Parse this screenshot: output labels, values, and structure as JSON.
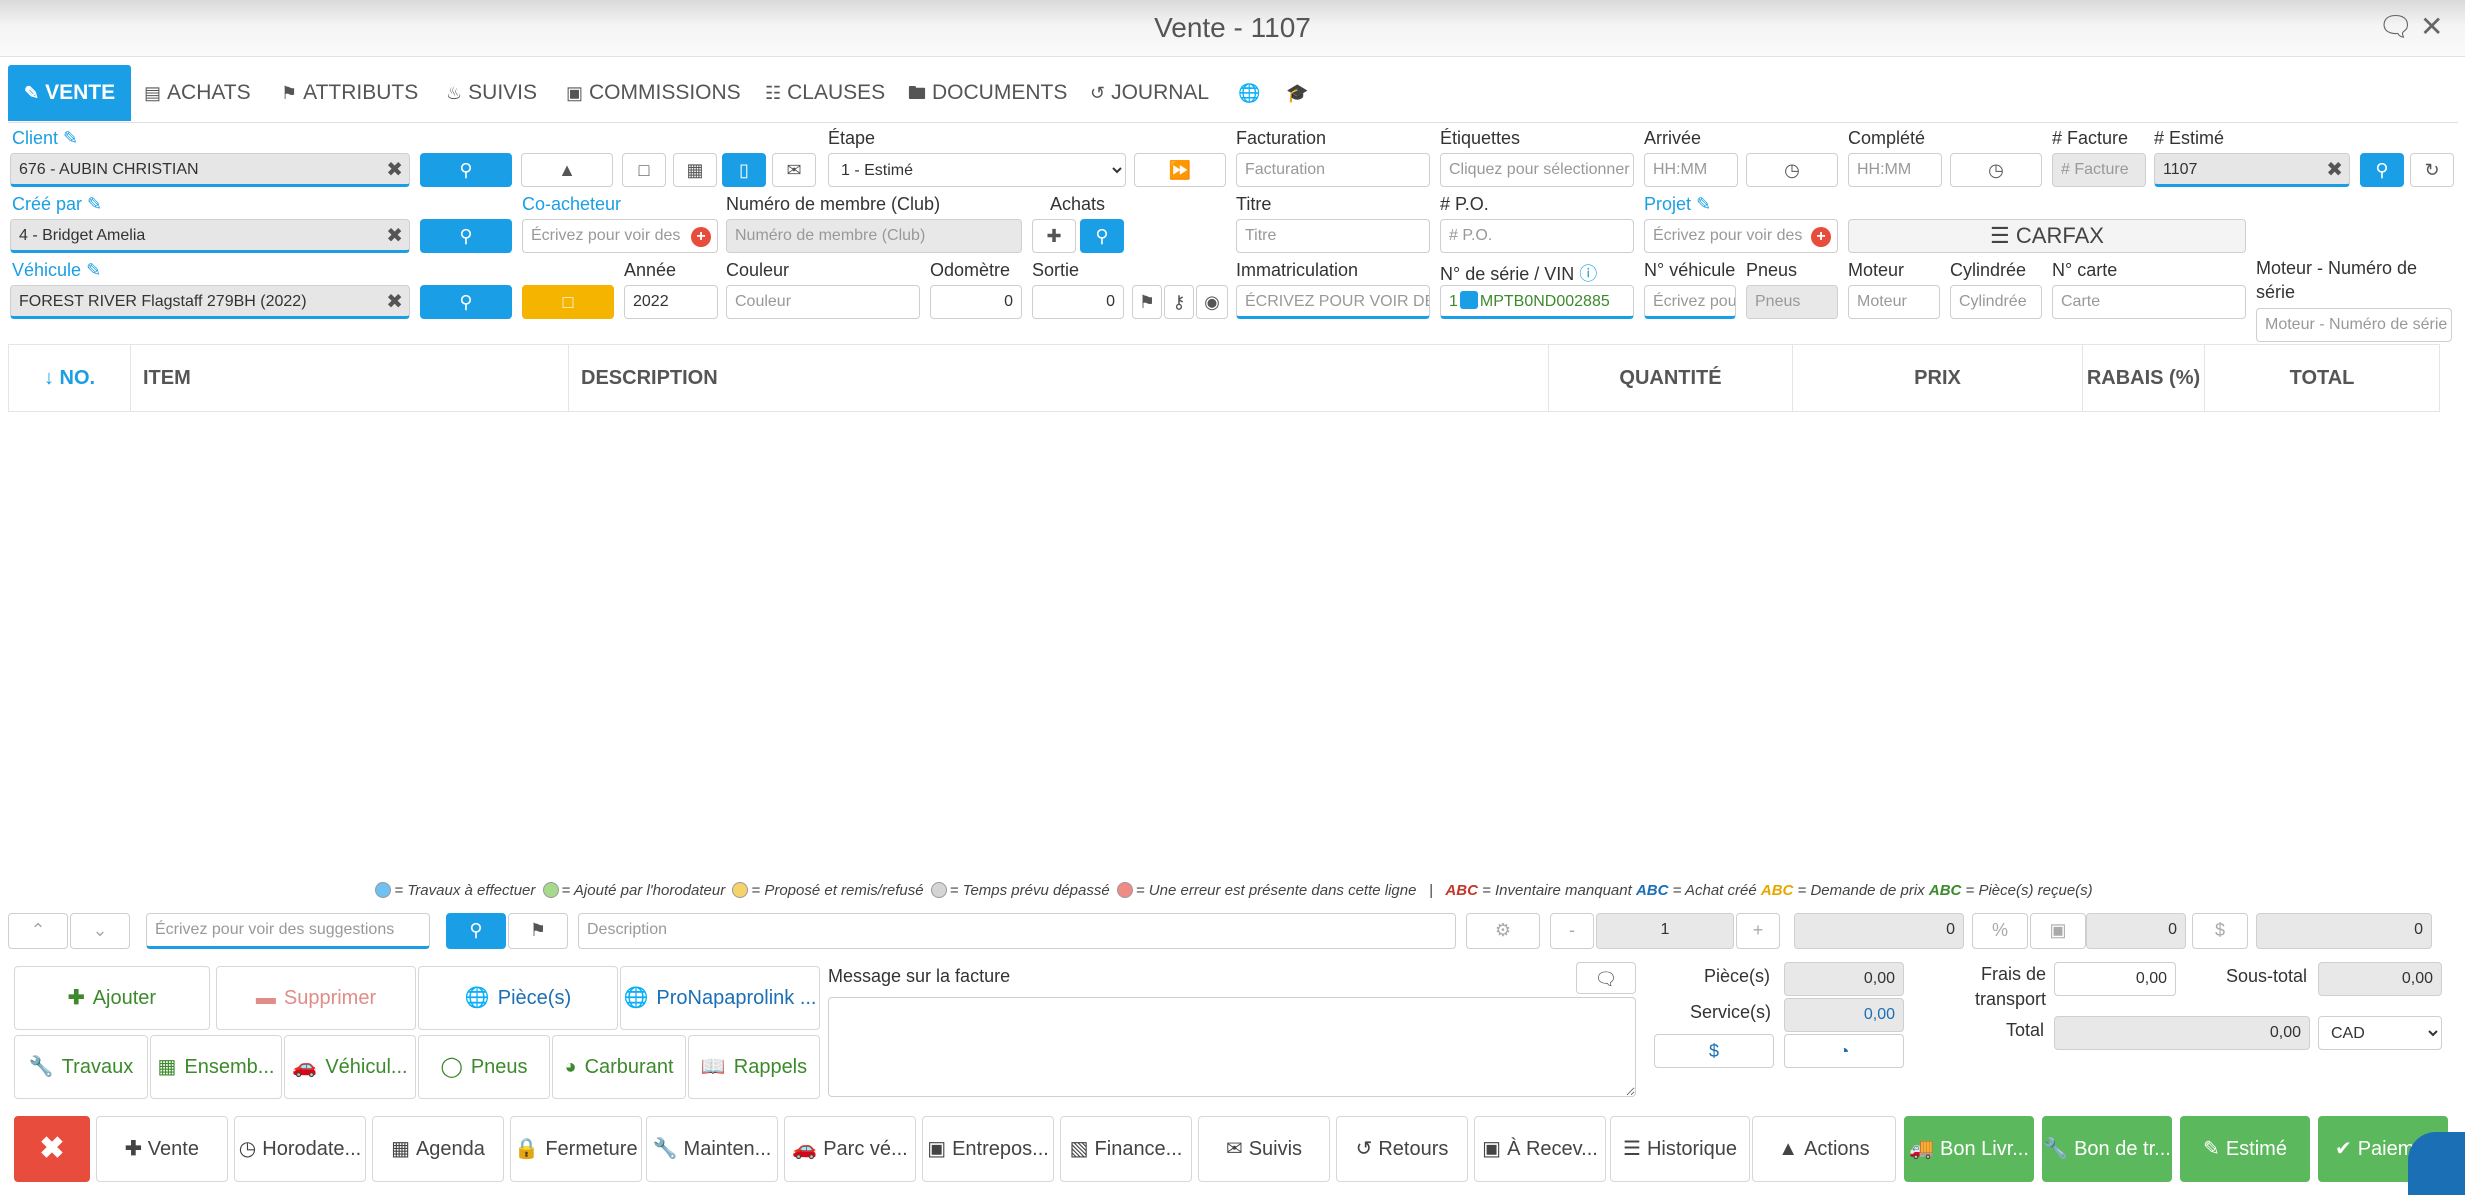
{
  "window": {
    "title": "Vente - 1107"
  },
  "tabs": [
    {
      "label": "VENTE",
      "icon": "edit-icon"
    },
    {
      "label": "ACHATS",
      "icon": "card-icon"
    },
    {
      "label": "ATTRIBUTS",
      "icon": "tags-icon"
    },
    {
      "label": "SUIVIS",
      "icon": "bell-icon"
    },
    {
      "label": "COMMISSIONS",
      "icon": "money-icon"
    },
    {
      "label": "CLAUSES",
      "icon": "file-icon"
    },
    {
      "label": "DOCUMENTS",
      "icon": "folder-icon"
    },
    {
      "label": "JOURNAL",
      "icon": "history-icon"
    }
  ],
  "form": {
    "client_label": "Client",
    "client_value": "676 - AUBIN CHRISTIAN",
    "cree_par_label": "Créé par",
    "cree_par_value": "4 - Bridget Amelia",
    "vehicule_label": "Véhicule",
    "vehicule_value": "FOREST RIVER Flagstaff 279BH (2022)",
    "etape_label": "Étape",
    "etape_value": "1 - Estimé",
    "coacheteur_label": "Co-acheteur",
    "coacheteur_placeholder": "Écrivez pour voir des",
    "membre_label": "Numéro de membre (Club)",
    "membre_placeholder": "Numéro de membre (Club)",
    "achats_label": "Achats",
    "annee_label": "Année",
    "annee_value": "2022",
    "couleur_label": "Couleur",
    "couleur_placeholder": "Couleur",
    "odometre_label": "Odomètre",
    "odometre_value": "0",
    "sortie_label": "Sortie",
    "sortie_value": "0",
    "facturation_label": "Facturation",
    "facturation_placeholder": "Facturation",
    "etiquettes_label": "Étiquettes",
    "etiquettes_placeholder": "Cliquez pour sélectionner",
    "arrivee_label": "Arrivée",
    "arrivee_placeholder": "HH:MM",
    "complete_label": "Complété",
    "complete_placeholder": "HH:MM",
    "facture_no_label": "# Facture",
    "facture_no_placeholder": "# Facture",
    "estime_no_label": "# Estimé",
    "estime_no_value": "1107",
    "titre_label": "Titre",
    "titre_placeholder": "Titre",
    "po_label": "# P.O.",
    "po_placeholder": "# P.O.",
    "projet_label": "Projet",
    "projet_placeholder": "Écrivez pour voir des",
    "carfax_label": "CARFAX",
    "immat_label": "Immatriculation",
    "immat_placeholder": "ÉCRIVEZ POUR VOIR DES",
    "vin_label": "N° de série / VIN",
    "vin_value": "MPTB0ND002885",
    "vin_prefix": "1",
    "no_vehicule_label": "N° véhicule",
    "no_vehicule_placeholder": "Écrivez pou",
    "pneus_label": "Pneus",
    "pneus_placeholder": "Pneus",
    "moteur_label": "Moteur",
    "moteur_placeholder": "Moteur",
    "cylindree_label": "Cylindrée",
    "cylindree_placeholder": "Cylindrée",
    "no_carte_label": "N° carte",
    "no_carte_placeholder": "Carte",
    "moteur_serie_label": "Moteur - Numéro de série",
    "moteur_serie_placeholder": "Moteur - Numéro de série"
  },
  "grid": {
    "columns": [
      "↓ NO.",
      "ITEM",
      "DESCRIPTION",
      "QUANTITÉ",
      "PRIX",
      "RABAIS (%)",
      "TOTAL"
    ]
  },
  "legend": {
    "travaux": "= Travaux à effectuer",
    "horodateur": "= Ajouté par l'horodateur",
    "propose": "= Proposé et remis/refusé",
    "temps": "= Temps prévu dépassé",
    "erreur": "= Une erreur est présente dans cette ligne",
    "sep": "|",
    "abc": "ABC",
    "inventaire": "= Inventaire manquant",
    "achat": "= Achat créé",
    "demande": "= Demande de prix",
    "recue": "= Pièce(s) reçue(s)",
    "colors": {
      "blue": "#6ec1f0",
      "green": "#a7d98c",
      "yellow": "#f6d36a",
      "grey": "#d5d5d5",
      "red": "#f08a85"
    }
  },
  "entry": {
    "suggest_placeholder": "Écrivez pour voir des suggestions",
    "description_placeholder": "Description",
    "minus": "-",
    "qty": "1",
    "plus": "+",
    "price": "0",
    "rabais": "0",
    "total": "0"
  },
  "actions": [
    {
      "label": "Ajouter",
      "icon": "plus-icon"
    },
    {
      "label": "Supprimer",
      "icon": "minus-icon"
    },
    {
      "label": "Pièce(s)",
      "icon": "globe-icon"
    },
    {
      "label": "ProNapaprolink ...",
      "icon": "globe-icon"
    },
    {
      "label": "Travaux",
      "icon": "wrench-icon"
    },
    {
      "label": "Ensemb...",
      "icon": "grid-icon"
    },
    {
      "label": "Véhicul...",
      "icon": "car-icon"
    },
    {
      "label": "Pneus",
      "icon": "circle-icon"
    },
    {
      "label": "Carburant",
      "icon": "gauge-icon"
    },
    {
      "label": "Rappels",
      "icon": "book-icon"
    }
  ],
  "message": {
    "label": "Message sur la facture"
  },
  "totals": {
    "pieces_label": "Pièce(s)",
    "pieces_value": "0,00",
    "services_label": "Service(s)",
    "services_value": "0,00",
    "frais_label": "Frais de transport",
    "frais_value": "0,00",
    "sous_total_label": "Sous-total",
    "sous_total_value": "0,00",
    "total_label": "Total",
    "total_value": "0,00",
    "currency": "CAD"
  },
  "bottom": [
    {
      "label": "",
      "icon": "close-icon"
    },
    {
      "label": "Vente",
      "icon": "plus-icon"
    },
    {
      "label": "Horodate...",
      "icon": "clock-icon"
    },
    {
      "label": "Agenda",
      "icon": "calendar-icon"
    },
    {
      "label": "Fermeture",
      "icon": "lock-icon"
    },
    {
      "label": "Mainten...",
      "icon": "wrench-icon"
    },
    {
      "label": "Parc vé...",
      "icon": "car-icon"
    },
    {
      "label": "Entrepos...",
      "icon": "box-icon"
    },
    {
      "label": "Finance...",
      "icon": "calculator-icon"
    },
    {
      "label": "Suivis",
      "icon": "mail-icon"
    },
    {
      "label": "Retours",
      "icon": "undo-icon"
    },
    {
      "label": "À Recev...",
      "icon": "money-icon"
    },
    {
      "label": "Historique",
      "icon": "list-icon"
    },
    {
      "label": "Actions",
      "icon": "caret-up-icon"
    },
    {
      "label": "Bon Livr...",
      "icon": "truck-icon"
    },
    {
      "label": "Bon de tr...",
      "icon": "wrench-icon"
    },
    {
      "label": "Estimé",
      "icon": "edit-icon"
    },
    {
      "label": "Paiem...",
      "icon": "check-icon"
    }
  ]
}
